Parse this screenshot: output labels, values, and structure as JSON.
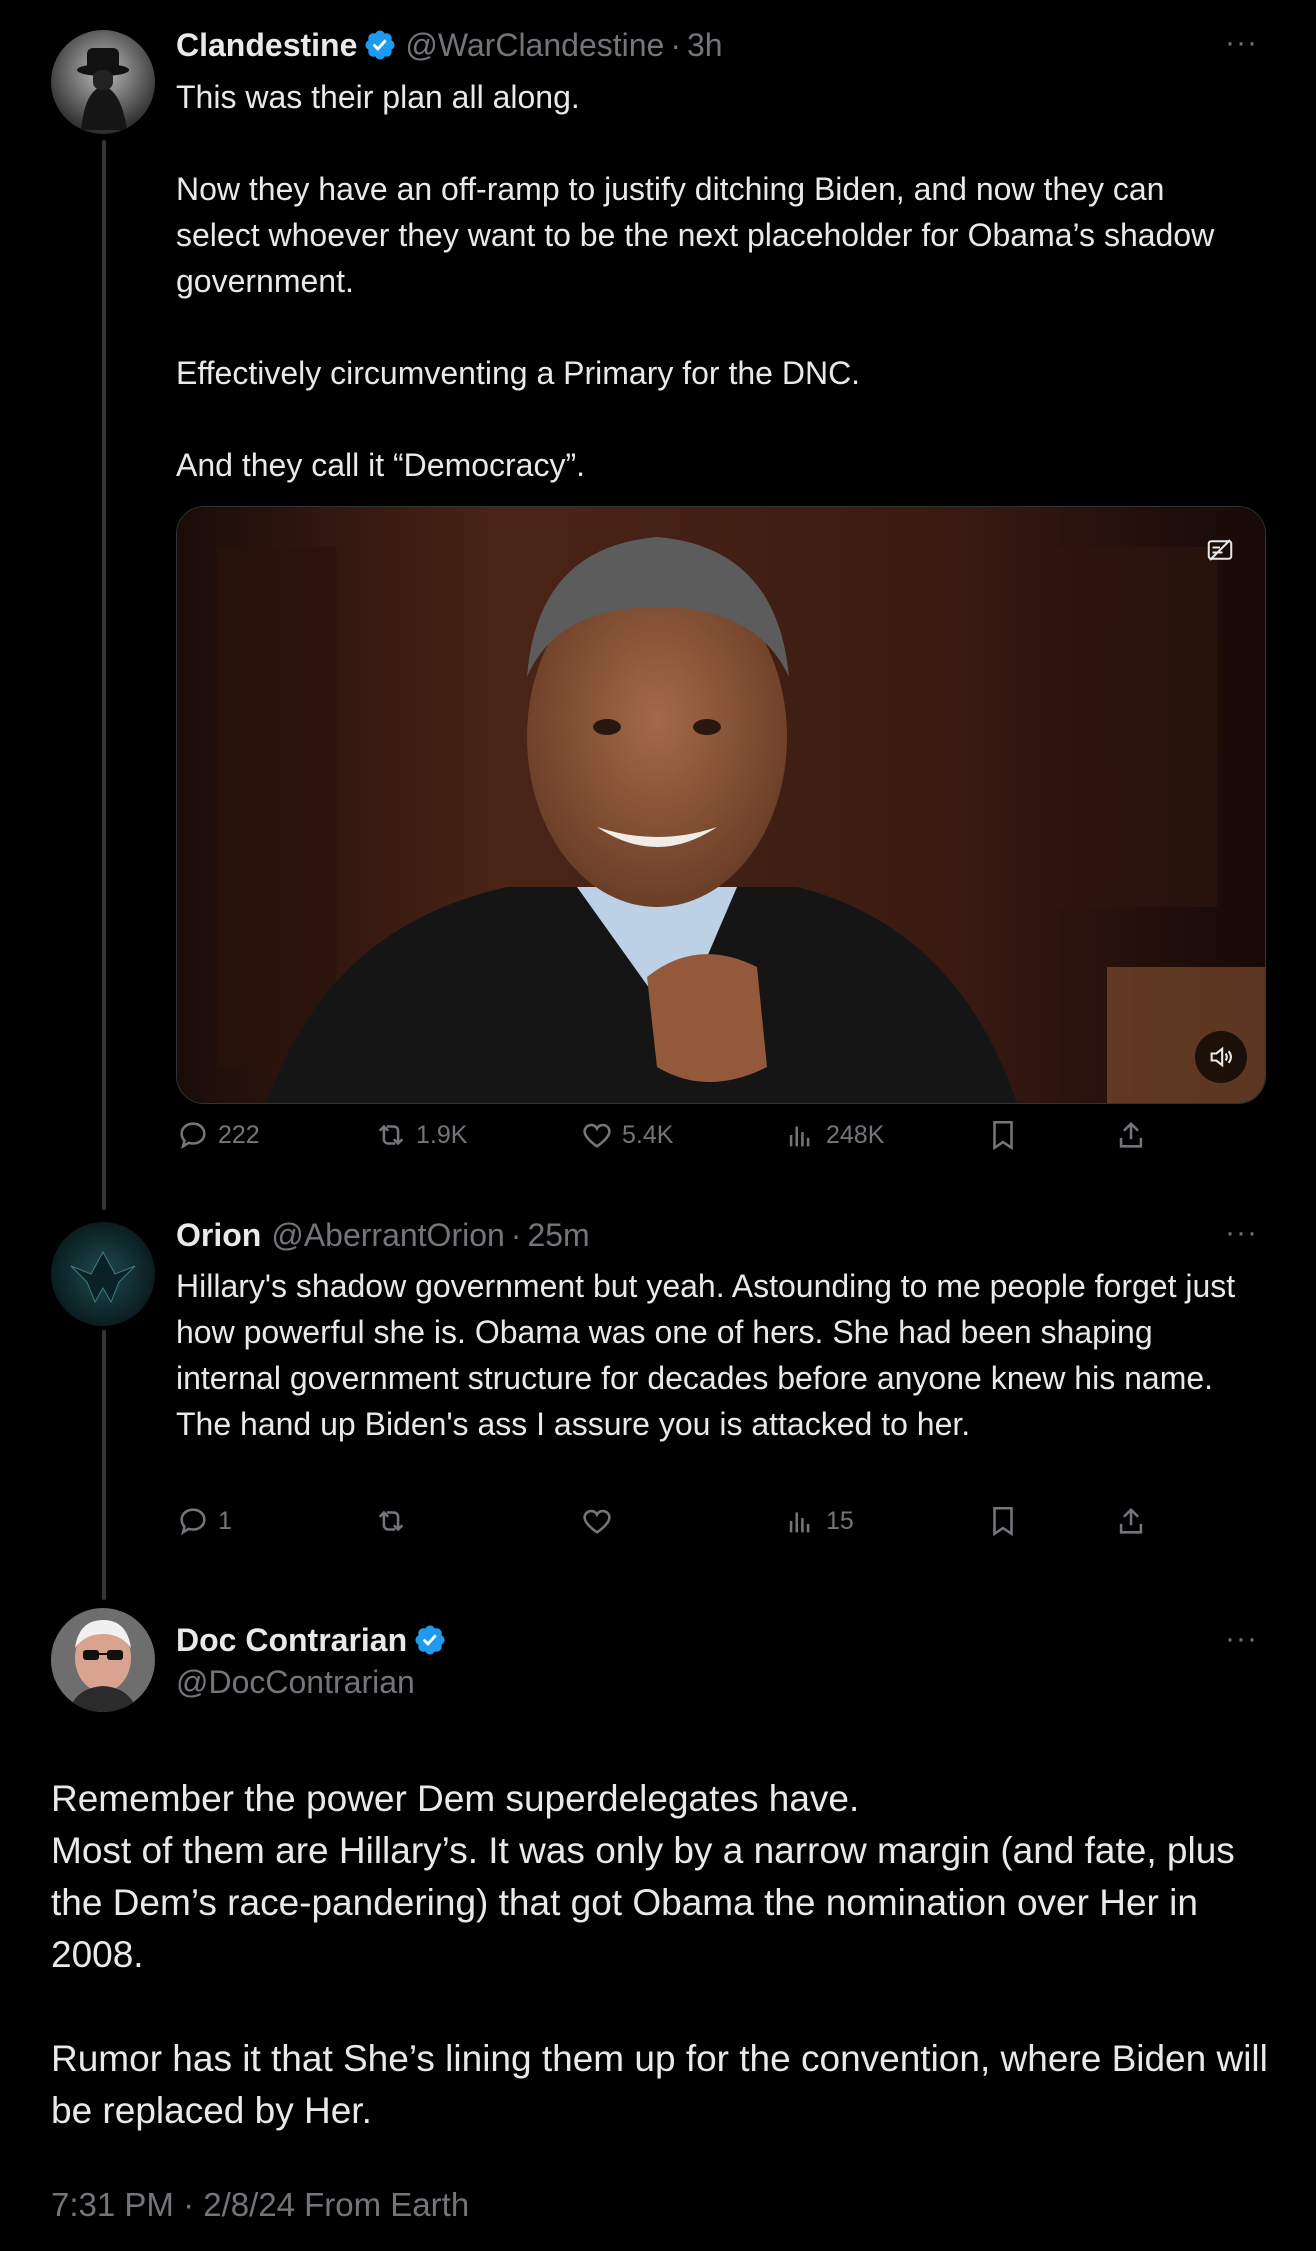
{
  "tweets": [
    {
      "name": "Clandestine",
      "handle": "@WarClandestine",
      "time": "3h",
      "paragraphs": [
        "This was their plan all along.",
        "",
        "Now they have an off-ramp to justify ditching Biden, and now they can select whoever they want to be the next placeholder for Obama’s shadow government.",
        "",
        "Effectively circumventing a Primary for the DNC.",
        "",
        "And they call it “Democracy”."
      ],
      "stats": {
        "replies": "222",
        "reposts": "1.9K",
        "likes": "5.4K",
        "views": "248K"
      }
    },
    {
      "name": "Orion",
      "handle": "@AberrantOrion",
      "time": "25m",
      "paragraphs": [
        "Hillary's shadow government but yeah.  Astounding to me people forget just how powerful she is.  Obama was one of hers.  She had been shaping internal government structure for decades before anyone knew his name.",
        "The hand up Biden's ass I assure you is attacked to her."
      ],
      "stats": {
        "replies": "1",
        "reposts": "",
        "likes": "",
        "views": "15"
      }
    }
  ],
  "main": {
    "name": "Doc Contrarian",
    "handle": "@DocContrarian",
    "paragraphs": [
      "Remember the power Dem superdelegates have.",
      "Most of them are Hillary’s. It was only by a narrow margin (and fate, plus the Dem’s race-pandering) that got Obama the nomination over Her in 2008.",
      "",
      "Rumor has it that She’s lining them up for the convention, where Biden will be replaced by Her."
    ],
    "footer": "7:31 PM · 2/8/24 From Earth"
  },
  "ui": {
    "separator": "·",
    "more": "···"
  },
  "colors": {
    "background": "#000000",
    "text": "#e7e9ea",
    "muted": "#71767b",
    "verified": "#1d9bf0",
    "line": "#333639"
  },
  "icons": [
    "reply-icon",
    "repost-icon",
    "like-icon",
    "views-icon",
    "bookmark-icon",
    "share-icon",
    "verified-badge-icon",
    "mute-icon",
    "alt-text-icon"
  ]
}
